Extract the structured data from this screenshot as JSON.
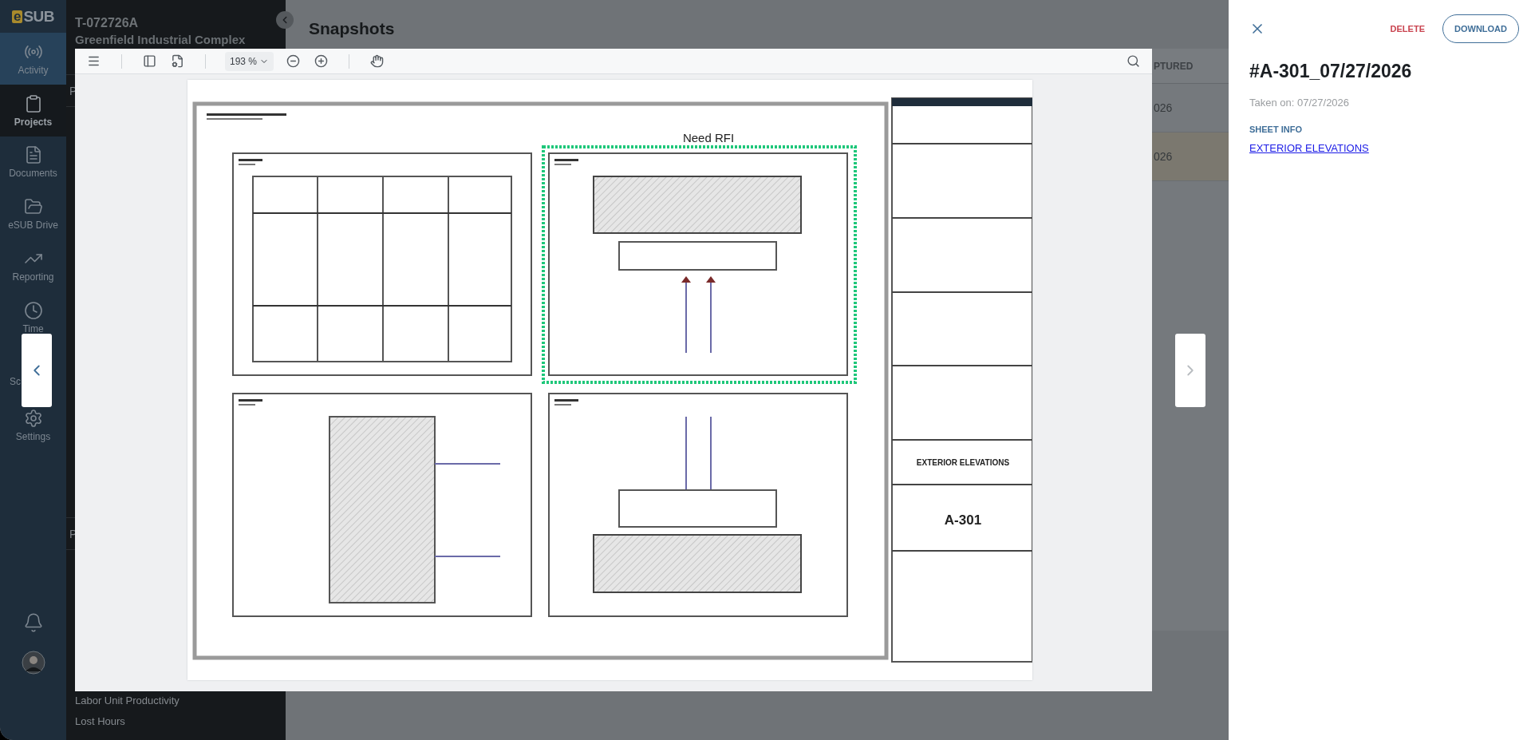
{
  "nav": {
    "logo": {
      "mark": "e",
      "text": "SUB"
    },
    "items": [
      {
        "kind": "activity",
        "label": "Activity",
        "selected": false,
        "hovered": true
      },
      {
        "kind": "projects",
        "label": "Projects",
        "selected": true,
        "hovered": false
      },
      {
        "kind": "documents",
        "label": "Documents",
        "selected": false,
        "hovered": false
      },
      {
        "kind": "drive",
        "label": "eSUB Drive",
        "selected": false,
        "hovered": false
      },
      {
        "kind": "reporting",
        "label": "Reporting",
        "selected": false,
        "hovered": false
      },
      {
        "kind": "time",
        "label": "Time",
        "selected": false,
        "hovered": false
      },
      {
        "kind": "scheduling",
        "label": "Sc",
        "selected": false,
        "hovered": false
      },
      {
        "kind": "settings",
        "label": "Settings",
        "selected": false,
        "hovered": false
      }
    ]
  },
  "project": {
    "code": "T-072726A",
    "name": "Greenfield Industrial Complex",
    "sections": [
      "P",
      "P"
    ],
    "links": [
      "Labor Unit Productivity",
      "Lost Hours"
    ]
  },
  "main": {
    "title": "Snapshots",
    "table": {
      "columns": [
        "PTURED"
      ],
      "rows": [
        {
          "cells": [
            "026"
          ],
          "selected": false
        },
        {
          "cells": [
            "026"
          ],
          "selected": true
        }
      ]
    }
  },
  "viewer": {
    "zoom": "193 %",
    "prev": {
      "disabled": false
    },
    "next": {
      "disabled": true
    },
    "sheet": {
      "annotation": "Need RFI",
      "sheet_title": "EXTERIOR ELEVATIONS",
      "sheet_number": "A-301"
    }
  },
  "details": {
    "delete": "DELETE",
    "download": "DOWNLOAD",
    "title": "#A-301_07/27/2026",
    "taken_on": "Taken on: 07/27/2026",
    "section": "SHEET INFO",
    "sheet_link": "EXTERIOR ELEVATIONS"
  }
}
